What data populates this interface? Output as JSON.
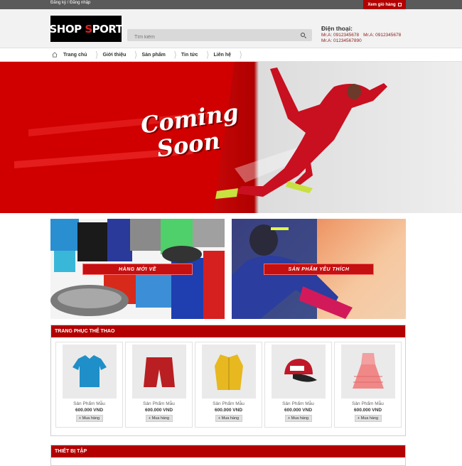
{
  "topbar": {
    "auth_label": "Đăng ký / Đăng nhập",
    "cart_label": "Xem giỏ hàng"
  },
  "header": {
    "logo_part1": "SHOP ",
    "logo_s": "S",
    "logo_part2": "PORT",
    "search_placeholder": "Tìm kiếm",
    "phone_title": "Điện thoại:",
    "phones": [
      [
        "Mr.A: 0912345678",
        "Mr.A: 0912345678"
      ],
      [
        "Mr.A: 01234567890"
      ]
    ]
  },
  "nav": {
    "items": [
      "Trang chủ",
      "Giới thiệu",
      "Sản phẩm",
      "Tin tức",
      "Liên hệ"
    ]
  },
  "hero": {
    "line1": "Coming",
    "line2": "Soon"
  },
  "promos": {
    "left_label": "HÀNG MỚI VỀ",
    "right_label": "SẢN PHẨM YÊU THÍCH"
  },
  "section1": {
    "title": "TRANG PHỤC THỂ THAO",
    "products": [
      {
        "name": "Sản Phẩm Mẫu",
        "price": "600.000 VND",
        "button": "+ Mua hàng",
        "icon": "polo-shirt-image"
      },
      {
        "name": "Sản Phẩm Mẫu",
        "price": "600.000 VND",
        "button": "+ Mua hàng",
        "icon": "shorts-image"
      },
      {
        "name": "Sản Phẩm Mẫu",
        "price": "600.000 VND",
        "button": "+ Mua hàng",
        "icon": "jacket-image"
      },
      {
        "name": "Sản Phẩm Mẫu",
        "price": "600.000 VND",
        "button": "+ Mua hàng",
        "icon": "cap-image"
      },
      {
        "name": "Sản Phẩm Mẫu",
        "price": "600.000 VND",
        "button": "+ Mua hàng",
        "icon": "skirt-image"
      }
    ]
  },
  "section2": {
    "title": "THIẾT BỊ TẬP"
  },
  "colors": {
    "brand_red": "#b30000",
    "topbar_gray": "#5a5a5a"
  }
}
